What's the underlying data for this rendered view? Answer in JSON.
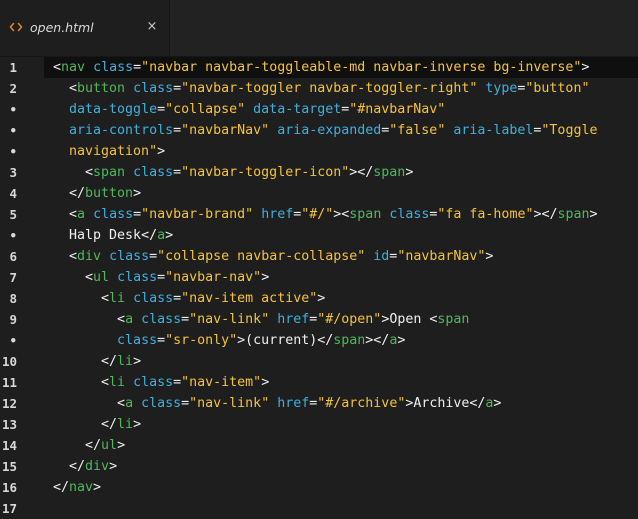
{
  "tab": {
    "title": "open.html",
    "icon": "code-file-icon",
    "close_glyph": "×"
  },
  "colors": {
    "background": "#1e1e1e",
    "tab_bar": "#222222",
    "active_line": "#0f0f0f",
    "tag": "#4fb95b",
    "attribute": "#3fb0e0",
    "string": "#f5c33b",
    "punctuation": "#f0f0f0",
    "icon_orange": "#e8822f"
  },
  "editor": {
    "lines": [
      {
        "num": "1",
        "tokens": [
          [
            "p",
            "<"
          ],
          [
            "g",
            "nav"
          ],
          [
            "p",
            " "
          ],
          [
            "b",
            "class"
          ],
          [
            "p",
            "="
          ],
          [
            "y",
            "\"navbar navbar-toggleable-md navbar-inverse bg-inverse\""
          ],
          [
            "p",
            ">"
          ]
        ]
      },
      {
        "num": "2",
        "tokens": [
          [
            "p",
            "  <"
          ],
          [
            "g",
            "button"
          ],
          [
            "p",
            " "
          ],
          [
            "b",
            "class"
          ],
          [
            "p",
            "="
          ],
          [
            "y",
            "\"navbar-toggler navbar-toggler-right\""
          ],
          [
            "p",
            " "
          ],
          [
            "b",
            "type"
          ],
          [
            "p",
            "="
          ],
          [
            "y",
            "\"button\""
          ]
        ]
      },
      {
        "num": "•",
        "tokens": [
          [
            "p",
            "  "
          ],
          [
            "b",
            "data-toggle"
          ],
          [
            "p",
            "="
          ],
          [
            "y",
            "\"collapse\""
          ],
          [
            "p",
            " "
          ],
          [
            "b",
            "data-target"
          ],
          [
            "p",
            "="
          ],
          [
            "y",
            "\"#navbarNav\""
          ]
        ]
      },
      {
        "num": "•",
        "tokens": [
          [
            "p",
            "  "
          ],
          [
            "b",
            "aria-controls"
          ],
          [
            "p",
            "="
          ],
          [
            "y",
            "\"navbarNav\""
          ],
          [
            "p",
            " "
          ],
          [
            "b",
            "aria-expanded"
          ],
          [
            "p",
            "="
          ],
          [
            "y",
            "\"false\""
          ],
          [
            "p",
            " "
          ],
          [
            "b",
            "aria-label"
          ],
          [
            "p",
            "="
          ],
          [
            "y",
            "\"Toggle"
          ]
        ]
      },
      {
        "num": "•",
        "tokens": [
          [
            "y",
            "  navigation\""
          ],
          [
            "p",
            ">"
          ]
        ]
      },
      {
        "num": "3",
        "tokens": [
          [
            "p",
            "    <"
          ],
          [
            "g",
            "span"
          ],
          [
            "p",
            " "
          ],
          [
            "b",
            "class"
          ],
          [
            "p",
            "="
          ],
          [
            "y",
            "\"navbar-toggler-icon\""
          ],
          [
            "p",
            "></"
          ],
          [
            "g",
            "span"
          ],
          [
            "p",
            ">"
          ]
        ]
      },
      {
        "num": "4",
        "tokens": [
          [
            "p",
            "  </"
          ],
          [
            "g",
            "button"
          ],
          [
            "p",
            ">"
          ]
        ]
      },
      {
        "num": "5",
        "tokens": [
          [
            "p",
            "  <"
          ],
          [
            "g",
            "a"
          ],
          [
            "p",
            " "
          ],
          [
            "b",
            "class"
          ],
          [
            "p",
            "="
          ],
          [
            "y",
            "\"navbar-brand\""
          ],
          [
            "p",
            " "
          ],
          [
            "b",
            "href"
          ],
          [
            "p",
            "="
          ],
          [
            "y",
            "\"#/\""
          ],
          [
            "p",
            "><"
          ],
          [
            "g",
            "span"
          ],
          [
            "p",
            " "
          ],
          [
            "b",
            "class"
          ],
          [
            "p",
            "="
          ],
          [
            "y",
            "\"fa fa-home\""
          ],
          [
            "p",
            "></"
          ],
          [
            "g",
            "span"
          ],
          [
            "p",
            ">"
          ]
        ]
      },
      {
        "num": "•",
        "tokens": [
          [
            "t",
            "  Halp Desk"
          ],
          [
            "p",
            "</"
          ],
          [
            "g",
            "a"
          ],
          [
            "p",
            ">"
          ]
        ]
      },
      {
        "num": "6",
        "tokens": [
          [
            "p",
            "  <"
          ],
          [
            "g",
            "div"
          ],
          [
            "p",
            " "
          ],
          [
            "b",
            "class"
          ],
          [
            "p",
            "="
          ],
          [
            "y",
            "\"collapse navbar-collapse\""
          ],
          [
            "p",
            " "
          ],
          [
            "b",
            "id"
          ],
          [
            "p",
            "="
          ],
          [
            "y",
            "\"navbarNav\""
          ],
          [
            "p",
            ">"
          ]
        ]
      },
      {
        "num": "7",
        "tokens": [
          [
            "p",
            "    <"
          ],
          [
            "g",
            "ul"
          ],
          [
            "p",
            " "
          ],
          [
            "b",
            "class"
          ],
          [
            "p",
            "="
          ],
          [
            "y",
            "\"navbar-nav\""
          ],
          [
            "p",
            ">"
          ]
        ]
      },
      {
        "num": "8",
        "tokens": [
          [
            "p",
            "      <"
          ],
          [
            "g",
            "li"
          ],
          [
            "p",
            " "
          ],
          [
            "b",
            "class"
          ],
          [
            "p",
            "="
          ],
          [
            "y",
            "\"nav-item active\""
          ],
          [
            "p",
            ">"
          ]
        ]
      },
      {
        "num": "9",
        "tokens": [
          [
            "p",
            "        <"
          ],
          [
            "g",
            "a"
          ],
          [
            "p",
            " "
          ],
          [
            "b",
            "class"
          ],
          [
            "p",
            "="
          ],
          [
            "y",
            "\"nav-link\""
          ],
          [
            "p",
            " "
          ],
          [
            "b",
            "href"
          ],
          [
            "p",
            "="
          ],
          [
            "y",
            "\"#/open\""
          ],
          [
            "p",
            ">"
          ],
          [
            "t",
            "Open "
          ],
          [
            "p",
            "<"
          ],
          [
            "g",
            "span"
          ]
        ]
      },
      {
        "num": "•",
        "tokens": [
          [
            "p",
            "        "
          ],
          [
            "b",
            "class"
          ],
          [
            "p",
            "="
          ],
          [
            "y",
            "\"sr-only\""
          ],
          [
            "p",
            ">"
          ],
          [
            "t",
            "(current)"
          ],
          [
            "p",
            "</"
          ],
          [
            "g",
            "span"
          ],
          [
            "p",
            "></"
          ],
          [
            "g",
            "a"
          ],
          [
            "p",
            ">"
          ]
        ]
      },
      {
        "num": "10",
        "tokens": [
          [
            "p",
            "      </"
          ],
          [
            "g",
            "li"
          ],
          [
            "p",
            ">"
          ]
        ]
      },
      {
        "num": "11",
        "tokens": [
          [
            "p",
            "      <"
          ],
          [
            "g",
            "li"
          ],
          [
            "p",
            " "
          ],
          [
            "b",
            "class"
          ],
          [
            "p",
            "="
          ],
          [
            "y",
            "\"nav-item\""
          ],
          [
            "p",
            ">"
          ]
        ]
      },
      {
        "num": "12",
        "tokens": [
          [
            "p",
            "        <"
          ],
          [
            "g",
            "a"
          ],
          [
            "p",
            " "
          ],
          [
            "b",
            "class"
          ],
          [
            "p",
            "="
          ],
          [
            "y",
            "\"nav-link\""
          ],
          [
            "p",
            " "
          ],
          [
            "b",
            "href"
          ],
          [
            "p",
            "="
          ],
          [
            "y",
            "\"#/archive\""
          ],
          [
            "p",
            ">"
          ],
          [
            "t",
            "Archive"
          ],
          [
            "p",
            "</"
          ],
          [
            "g",
            "a"
          ],
          [
            "p",
            ">"
          ]
        ]
      },
      {
        "num": "13",
        "tokens": [
          [
            "p",
            "      </"
          ],
          [
            "g",
            "li"
          ],
          [
            "p",
            ">"
          ]
        ]
      },
      {
        "num": "14",
        "tokens": [
          [
            "p",
            "    </"
          ],
          [
            "g",
            "ul"
          ],
          [
            "p",
            ">"
          ]
        ]
      },
      {
        "num": "15",
        "tokens": [
          [
            "p",
            "  </"
          ],
          [
            "g",
            "div"
          ],
          [
            "p",
            ">"
          ]
        ]
      },
      {
        "num": "16",
        "tokens": [
          [
            "p",
            "</"
          ],
          [
            "g",
            "nav"
          ],
          [
            "p",
            ">"
          ]
        ]
      },
      {
        "num": "17",
        "tokens": []
      }
    ]
  }
}
